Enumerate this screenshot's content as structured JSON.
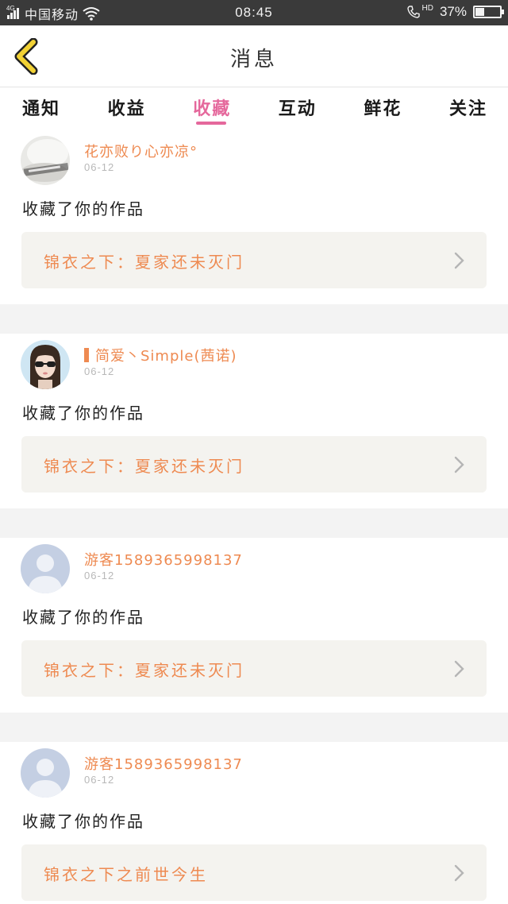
{
  "status_bar": {
    "network": "4G",
    "carrier": "中国移动",
    "time": "08:45",
    "hd": "HD",
    "battery": "37%",
    "battery_level": 0.37
  },
  "header": {
    "title": "消息",
    "back_icon": "chevron-left-icon",
    "accent_color": "#f2d235"
  },
  "tabs": [
    {
      "label": "通知",
      "active": false
    },
    {
      "label": "收益",
      "active": false
    },
    {
      "label": "收藏",
      "active": true
    },
    {
      "label": "互动",
      "active": false
    },
    {
      "label": "鲜花",
      "active": false
    },
    {
      "label": "关注",
      "active": false
    }
  ],
  "feed": [
    {
      "user": "花亦败り心亦凉°",
      "date": "06-12",
      "avatar": "cup-photo",
      "action": "收藏了你的作品",
      "work": "锦衣之下：夏家还未灭门"
    },
    {
      "user": "简爱丶Simple(茜诺)",
      "date": "06-12",
      "avatar": "girl-sunglasses",
      "action": "收藏了你的作品",
      "work": "锦衣之下：夏家还未灭门"
    },
    {
      "user": "游客1589365998137",
      "date": "06-12",
      "avatar": "default-user-icon",
      "action": "收藏了你的作品",
      "work": "锦衣之下：夏家还未灭门"
    },
    {
      "user": "游客1589365998137",
      "date": "06-12",
      "avatar": "default-user-icon",
      "action": "收藏了你的作品",
      "work": "锦衣之下之前世今生"
    }
  ],
  "colors": {
    "active_tab": "#e5689c",
    "username": "#ee8a51",
    "work_title": "#ee8a51",
    "card_bg": "#f4f3ef",
    "status_bar": "#3a3a3a"
  }
}
